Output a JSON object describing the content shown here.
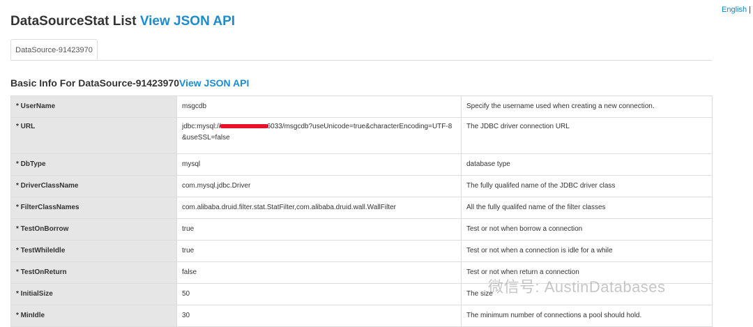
{
  "lang": {
    "english": "English",
    "sep": "|"
  },
  "header": {
    "title": "DataSourceStat List",
    "json_link": "View JSON API"
  },
  "tabs": [
    {
      "label": "DataSource-91423970"
    }
  ],
  "section": {
    "title": "Basic Info For DataSource-91423970",
    "json_link": "View JSON API"
  },
  "rows": [
    {
      "key": "* UserName",
      "value": "msgcdb",
      "desc": "Specify the username used when creating a new connection."
    },
    {
      "key": "* URL",
      "value_prefix": "jdbc:mysql://",
      "value_suffix": "6033/msgcdb?useUnicode=true&characterEncoding=UTF-8&useSSL=false",
      "desc": "The JDBC driver connection URL"
    },
    {
      "key": "* DbType",
      "value": "mysql",
      "desc": "database type"
    },
    {
      "key": "* DriverClassName",
      "value": "com.mysql.jdbc.Driver",
      "desc": "The fully qualifed name of the JDBC driver class"
    },
    {
      "key": "* FilterClassNames",
      "value": "com.alibaba.druid.filter.stat.StatFilter,com.alibaba.druid.wall.WallFilter",
      "desc": "All the fully qualifed name of the filter classes"
    },
    {
      "key": "* TestOnBorrow",
      "value": "true",
      "desc": "Test or not when borrow a connection"
    },
    {
      "key": "* TestWhileIdle",
      "value": "true",
      "desc": "Test or not when a connection is idle for a while"
    },
    {
      "key": "* TestOnReturn",
      "value": "false",
      "desc": "Test or not when return a connection"
    },
    {
      "key": "* InitialSize",
      "value": "50",
      "desc": "The size"
    },
    {
      "key": "* MinIdle",
      "value": "30",
      "desc": "The minimum number of connections a pool should hold."
    }
  ],
  "watermark": "微信号: AustinDatabases"
}
